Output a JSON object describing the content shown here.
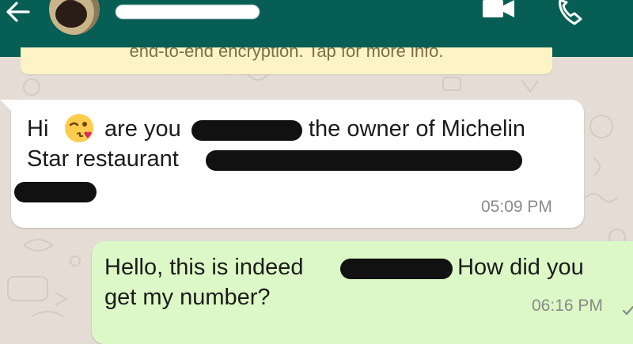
{
  "header": {
    "contact_name": "",
    "back_icon": "arrow-left-icon",
    "video_icon": "videocam-icon",
    "call_icon": "phone-icon"
  },
  "encryption_banner": {
    "text": "end-to-end encryption. Tap for more info."
  },
  "messages": [
    {
      "direction": "incoming",
      "line1_a": "Hi",
      "line1_b": "are you",
      "line1_c": "the owner of Michelin",
      "line2": "Star restaurant",
      "emoji": "winking-face-with-kiss-emoji",
      "time": "05:09 PM"
    },
    {
      "direction": "outgoing",
      "line1_a": "Hello, this is indeed",
      "line1_b": ". How did you",
      "line2": "get my number?",
      "time": "06:16 PM",
      "status_icon": "delivered-tick-icon"
    }
  ],
  "colors": {
    "header_bg": "#075e54",
    "chat_bg": "#e5ddd5",
    "incoming_bubble": "#ffffff",
    "outgoing_bubble": "#dcf8c6",
    "banner_bg": "#fdf4c5"
  }
}
